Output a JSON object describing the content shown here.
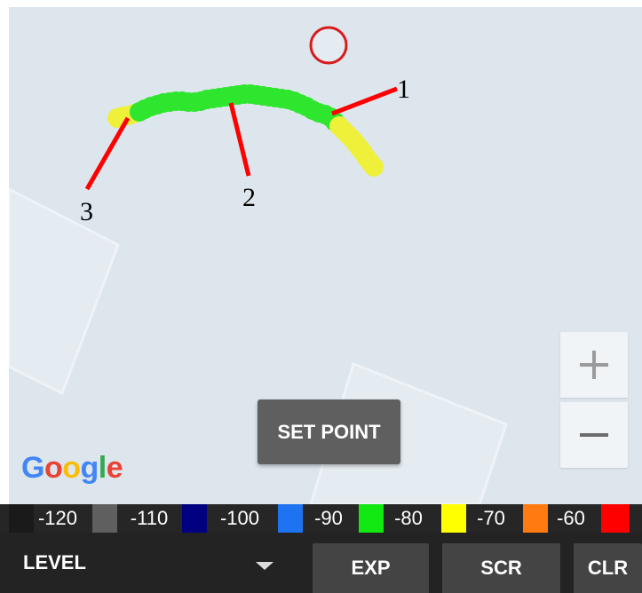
{
  "map": {
    "attribution": "Google",
    "set_point_label": "SET POINT",
    "zoom_in_icon": "plus-icon",
    "zoom_out_icon": "minus-icon",
    "target_marker_icon": "circle-target-icon"
  },
  "callouts": [
    "1",
    "2",
    "3"
  ],
  "legend": [
    {
      "label": "-120",
      "color": "#1a1a1a"
    },
    {
      "label": "-110",
      "color": "#5f5f5f"
    },
    {
      "label": "-100",
      "color": "#000080"
    },
    {
      "label": "-90",
      "color": "#1e74f0"
    },
    {
      "label": "-80",
      "color": "#12e812"
    },
    {
      "label": "-70",
      "color": "#ffff00"
    },
    {
      "label": "-60",
      "color": "#ff7a10"
    },
    {
      "label": "",
      "color": "#ff0000"
    }
  ],
  "toolbar": {
    "level_label": "LEVEL",
    "exp_label": "EXP",
    "scr_label": "SCR",
    "clr_label": "CLR"
  },
  "colors": {
    "path_good": "#2ee62e",
    "path_warn": "#eef03a",
    "callout_line": "#ff0000",
    "map_bg": "#dde6ed"
  }
}
